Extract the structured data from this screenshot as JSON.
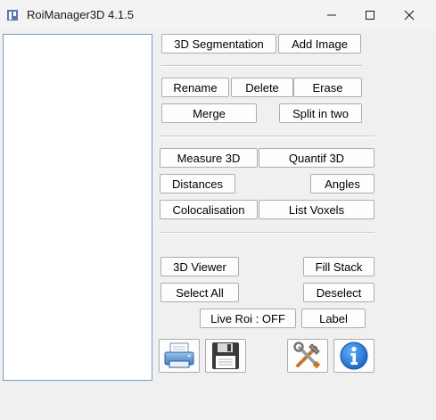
{
  "window": {
    "title": "RoiManager3D 4.1.5"
  },
  "titlebar": {
    "app_icon": "roi-manager-icon",
    "minimize_icon": "minimize-icon",
    "maximize_icon": "maximize-icon",
    "close_icon": "close-icon"
  },
  "buttons": {
    "segmentation": "3D Segmentation",
    "add_image": "Add Image",
    "rename": "Rename",
    "delete": "Delete",
    "erase": "Erase",
    "merge": "Merge",
    "split": "Split in two",
    "measure": "Measure 3D",
    "quantif": "Quantif 3D",
    "distances": "Distances",
    "angles": "Angles",
    "colocalisation": "Colocalisation",
    "list_voxels": "List Voxels",
    "viewer": "3D Viewer",
    "fill_stack": "Fill Stack",
    "select_all": "Select All",
    "deselect": "Deselect",
    "live_roi": "Live Roi : OFF",
    "label": "Label"
  },
  "icon_buttons": {
    "load": "printer-icon",
    "save": "floppy-disk-icon",
    "settings": "tools-icon",
    "about": "info-icon"
  },
  "colors": {
    "window_bg": "#f0f0f0",
    "list_border": "#7a9cc6",
    "button_border": "#adadad",
    "info_blue": "#1a73c9"
  }
}
